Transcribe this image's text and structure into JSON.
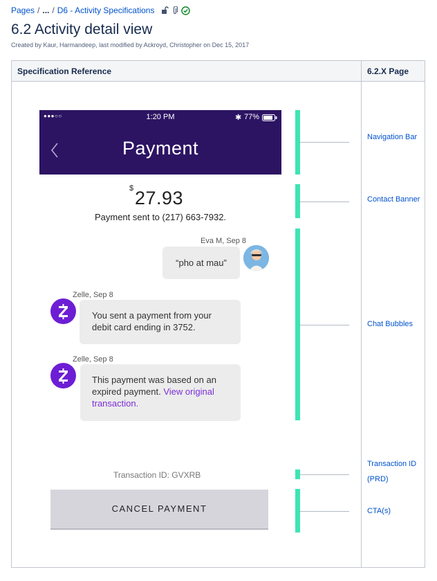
{
  "breadcrumb": {
    "pages": "Pages",
    "ellipsis": "...",
    "current": "D6 - Activity Specifications"
  },
  "page": {
    "title": "6.2 Activity detail view",
    "byline": "Created by Kaur, Harmandeep, last modified by Ackroyd, Christopher on Dec 15, 2017"
  },
  "table": {
    "col1_header": "Specification Reference",
    "col2_header": "6.2.X Page"
  },
  "phone": {
    "signal": "●●●○○",
    "time": "1:20 PM",
    "battery": "77%",
    "nav_title": "Payment",
    "currency": "$",
    "amount": "27.93",
    "sent_to": "Payment sent to (217) 663-7932."
  },
  "chat": {
    "msg1_meta": "Eva M, Sep 8",
    "msg1_text": "“pho at mau”",
    "msg2_meta": "Zelle, Sep 8",
    "msg2_text": "You sent a payment from your debit card ending in 3752.",
    "msg3_meta": "Zelle, Sep 8",
    "msg3_text": "This payment was based on an expired payment.",
    "msg3_link": "View original transaction."
  },
  "transaction_id": "Transaction ID: GVXRB",
  "cta_label": "CANCEL PAYMENT",
  "annotations": {
    "nav": "Navigation Bar",
    "contact": "Contact Banner",
    "chat": "Chat Bubbles",
    "txid": "Transaction ID",
    "prd": "(PRD)",
    "cta": "CTA(s)"
  },
  "colors": {
    "nav_bg": "#2c1463",
    "zelle": "#6d1ed4",
    "marker": "#3ee4b4",
    "link": "#0052cc"
  }
}
